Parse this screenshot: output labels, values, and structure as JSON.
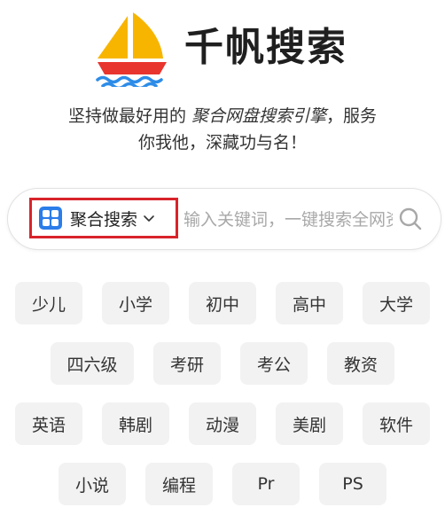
{
  "brand": {
    "name": "千帆搜索",
    "logo_icon": "sailboat-logo-icon"
  },
  "tagline": {
    "prefix": "坚持做最好用的 ",
    "highlight": "聚合网盘搜索引擎",
    "suffix_line1": "，服务",
    "line2": "你我他，深藏功与名！"
  },
  "search": {
    "engine_label": "聚合搜索",
    "engine_icon": "grid-apps-icon",
    "dropdown_icon": "chevron-down-icon",
    "placeholder": "输入关键词，一键搜索全网资源",
    "value": "",
    "search_icon": "search-icon"
  },
  "tags": [
    [
      "少儿",
      "小学",
      "初中",
      "高中",
      "大学"
    ],
    [
      "四六级",
      "考研",
      "考公",
      "教资"
    ],
    [
      "英语",
      "韩剧",
      "动漫",
      "美剧",
      "软件"
    ],
    [
      "小说",
      "编程",
      "Pr",
      "PS"
    ]
  ],
  "colors": {
    "highlight_box": "#d8232a",
    "engine_icon_bg": "#2b7de9",
    "tag_bg": "#f2f2f2",
    "sail_yellow": "#f7b500",
    "hull_red": "#e8352e",
    "wave_blue": "#2d8ce8"
  }
}
